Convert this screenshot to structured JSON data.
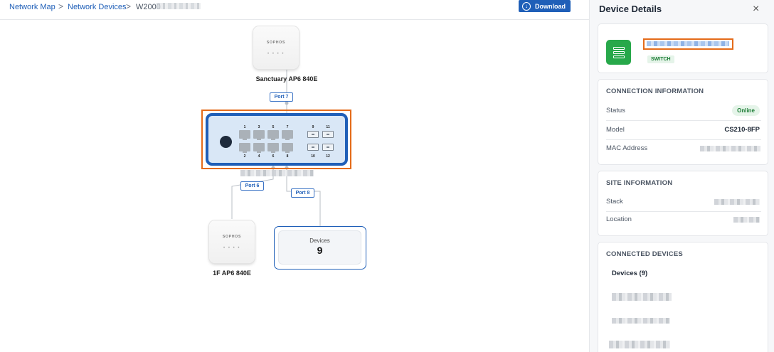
{
  "breadcrumb": {
    "items": [
      "Network Map",
      "Network Devices",
      "W2000"
    ],
    "separator": ">"
  },
  "toolbar": {
    "download_label": "Download",
    "download_icon": "download-icon"
  },
  "map": {
    "top_device": {
      "brand": "SOPHOS",
      "label": "Sanctuary AP6 840E"
    },
    "uplink_port": "Port 7",
    "switch": {
      "top_port_numbers": [
        "1",
        "3",
        "5",
        "7"
      ],
      "bottom_port_numbers": [
        "2",
        "4",
        "6",
        "8"
      ],
      "sfp_top_numbers": [
        "9",
        "11"
      ],
      "sfp_bottom_numbers": [
        "10",
        "12"
      ]
    },
    "left_port": "Port 6",
    "right_port": "Port 8",
    "bottom_device": {
      "brand": "SOPHOS",
      "label": "1F AP6 840E"
    },
    "devices_node": {
      "title": "Devices",
      "count": "9"
    },
    "colors": {
      "accent": "#1f5fb8",
      "selection": "#e46b1a"
    }
  },
  "panel": {
    "title": "Device Details",
    "close_icon": "close-icon",
    "device": {
      "type_badge": "SWITCH",
      "icon": "switch-icon",
      "icon_color": "#27a84a"
    },
    "connection": {
      "title": "CONNECTION INFORMATION",
      "status_label": "Status",
      "status_value": "Online",
      "model_label": "Model",
      "model_value": "CS210-8FP",
      "mac_label": "MAC Address"
    },
    "site": {
      "title": "SITE INFORMATION",
      "stack_label": "Stack",
      "location_label": "Location"
    },
    "connected": {
      "title": "CONNECTED DEVICES",
      "subtitle": "Devices (9)"
    }
  }
}
